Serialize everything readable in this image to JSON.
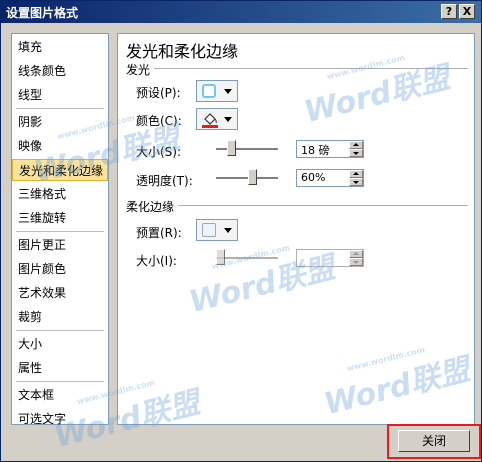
{
  "window": {
    "title": "设置图片格式",
    "help_label": "?",
    "close_label": "X"
  },
  "sidebar": {
    "items": [
      {
        "label": "填充"
      },
      {
        "label": "线条颜色"
      },
      {
        "label": "线型"
      },
      {
        "label": "阴影"
      },
      {
        "label": "映像"
      },
      {
        "label": "发光和柔化边缘",
        "selected": true
      },
      {
        "label": "三维格式"
      },
      {
        "label": "三维旋转"
      },
      {
        "label": "图片更正"
      },
      {
        "label": "图片颜色"
      },
      {
        "label": "艺术效果"
      },
      {
        "label": "裁剪"
      },
      {
        "label": "大小"
      },
      {
        "label": "属性"
      },
      {
        "label": "文本框"
      },
      {
        "label": "可选文字"
      }
    ]
  },
  "panel": {
    "heading": "发光和柔化边缘",
    "glow": {
      "section_label": "发光",
      "preset_label": "预设(P):",
      "color_label": "颜色(C):",
      "size_label": "大小(S):",
      "size_value": "18 磅",
      "size_level": 0.2,
      "transparency_label": "透明度(T):",
      "transparency_value": "60%",
      "transparency_level": 0.6
    },
    "soft_edges": {
      "section_label": "柔化边缘",
      "preset_label": "预置(R):",
      "size_label": "大小(I):",
      "size_value": "",
      "size_level": 0.0
    }
  },
  "footer": {
    "close_button_label": "关闭"
  },
  "watermark": {
    "text": "Word联盟",
    "url": "www.wordlm.com"
  },
  "colors": {
    "selected_bg": "#fce39b",
    "titlebar": "#0a246a",
    "glow_swatch": "#6ec8f0",
    "color_bar": "#e02020",
    "highlight_border": "#e02020"
  }
}
